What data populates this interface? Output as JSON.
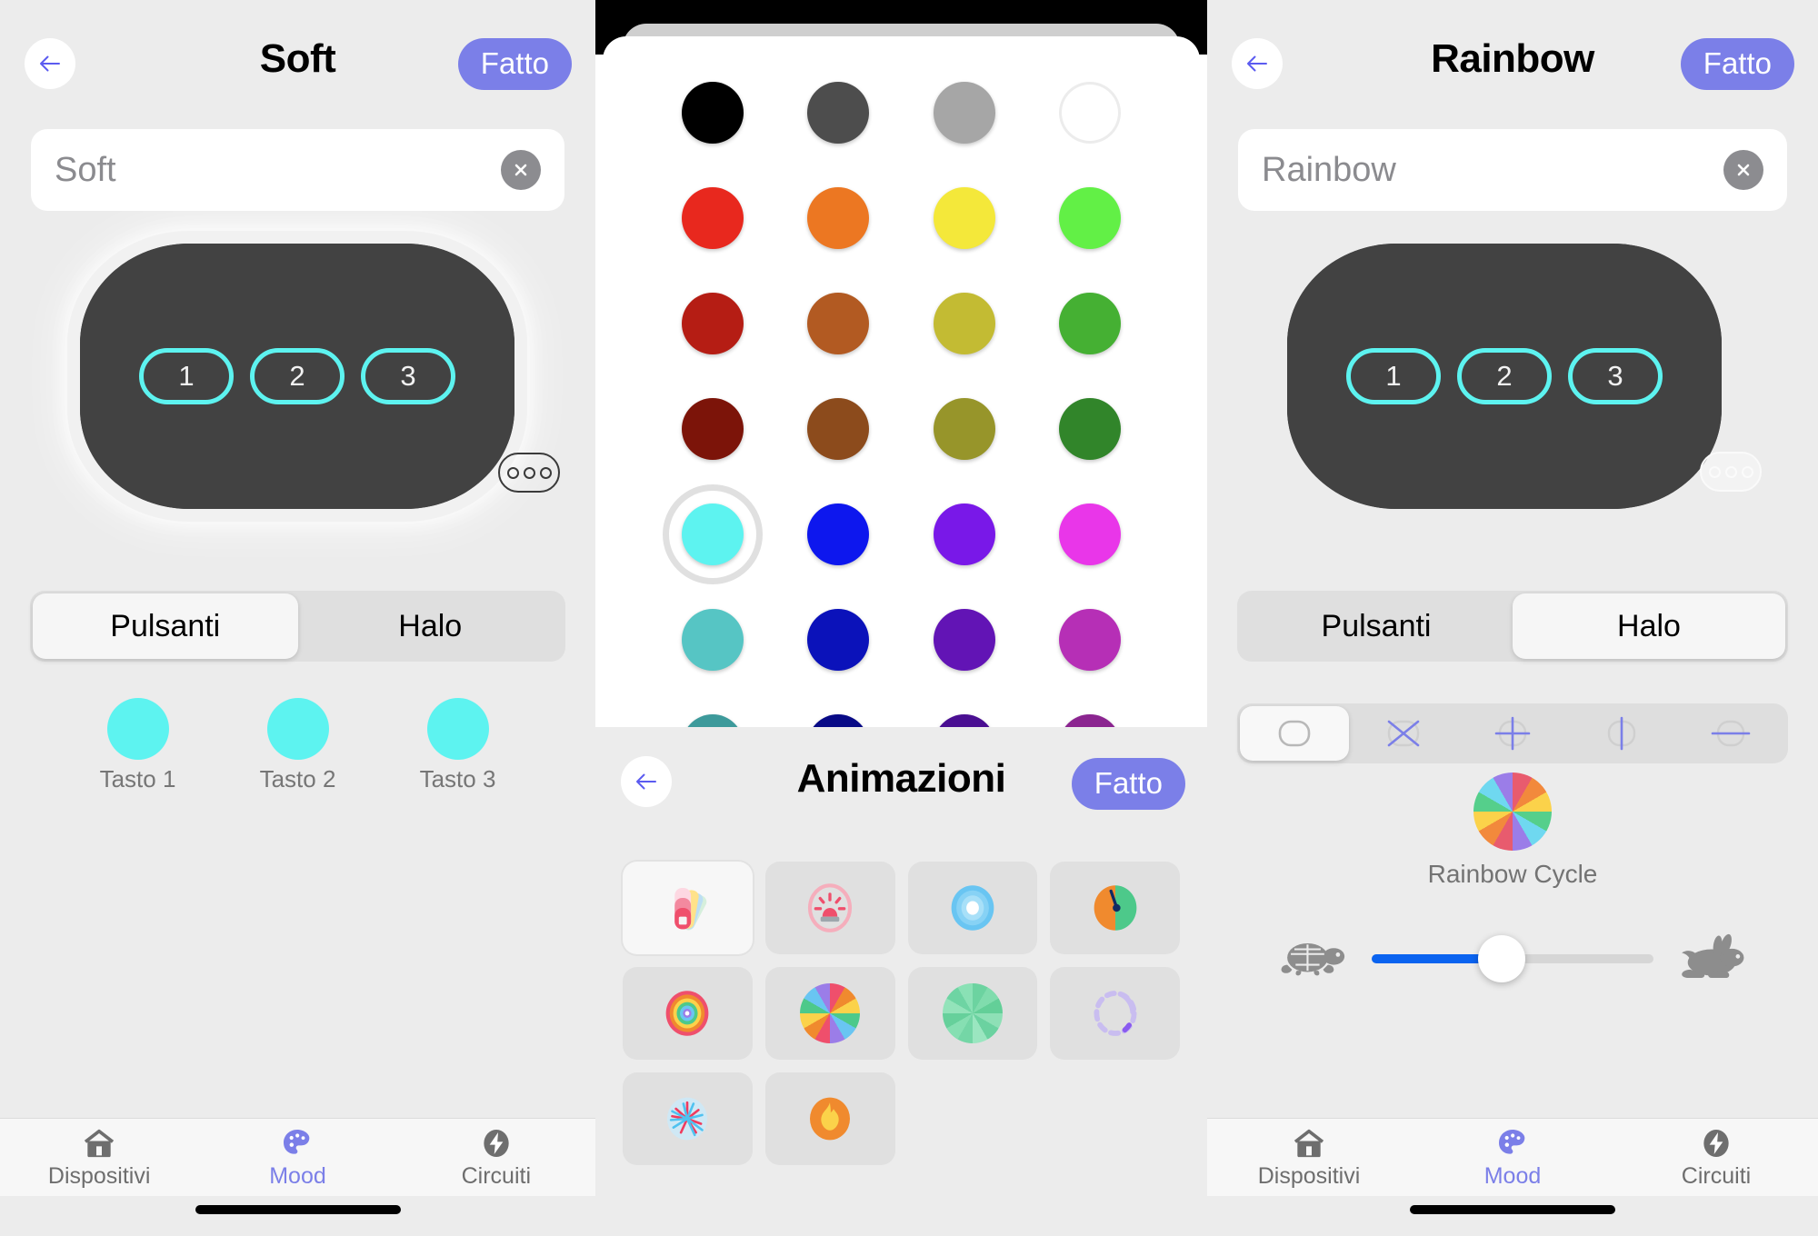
{
  "left_screen": {
    "header": {
      "title": "Soft",
      "done_label": "Fatto",
      "back_icon": "arrow-left-icon"
    },
    "name_field": {
      "value": "Soft",
      "clear_icon": "clear-circle-icon"
    },
    "device": {
      "keys": [
        "1",
        "2",
        "3"
      ],
      "halo_color": "#ffffff",
      "body_color": "#424242",
      "key_ring_color": "#5df3f0",
      "more_icon": "more-ellipsis-icon"
    },
    "segmented": {
      "options": [
        "Pulsanti",
        "Halo"
      ],
      "selected": "Pulsanti"
    },
    "buttons": [
      {
        "label": "Tasto 1",
        "color": "#5df3f0"
      },
      {
        "label": "Tasto 2",
        "color": "#5df3f0"
      },
      {
        "label": "Tasto 3",
        "color": "#5df3f0"
      }
    ],
    "tabbar": {
      "items": [
        {
          "label": "Dispositivi",
          "icon": "home-icon",
          "active": false
        },
        {
          "label": "Mood",
          "icon": "palette-icon",
          "active": true
        },
        {
          "label": "Circuiti",
          "icon": "bolt-icon",
          "active": false
        }
      ],
      "active_color": "#7b7fe8"
    }
  },
  "mid_screen": {
    "color_grid": {
      "columns": 4,
      "selected_index": 16,
      "colors": [
        "#000000",
        "#4d4d4d",
        "#a6a6a6",
        "#ffffff",
        "#e8281e",
        "#ec7722",
        "#f4e83a",
        "#62f046",
        "#b51d14",
        "#b25a22",
        "#c3bb33",
        "#45b033",
        "#7c1409",
        "#8c4b1c",
        "#97952a",
        "#31852a",
        "#5df3f0",
        "#0d17ee",
        "#7918e8",
        "#e936e9",
        "#56c5c4",
        "#0b12ba",
        "#6214b5",
        "#b62fb6",
        "#3d9a9b",
        "#080a86",
        "#4a0f92",
        "#8b2590"
      ]
    },
    "animations_sheet": {
      "header": {
        "title": "Animazioni",
        "done_label": "Fatto",
        "back_icon": "arrow-left-icon"
      },
      "items": [
        {
          "name": "color-swatch-fan-icon",
          "selected": true
        },
        {
          "name": "siren-beacon-icon",
          "selected": false
        },
        {
          "name": "pulse-ripple-icon",
          "selected": false
        },
        {
          "name": "two-tone-dial-icon",
          "selected": false
        },
        {
          "name": "rainbow-rings-icon",
          "selected": false
        },
        {
          "name": "color-wheel-icon",
          "selected": false
        },
        {
          "name": "green-fade-wheel-icon",
          "selected": false
        },
        {
          "name": "dashed-spinner-icon",
          "selected": false
        },
        {
          "name": "fireworks-icon",
          "selected": false
        },
        {
          "name": "flame-icon",
          "selected": false
        }
      ]
    }
  },
  "right_screen": {
    "header": {
      "title": "Rainbow",
      "done_label": "Fatto",
      "back_icon": "arrow-left-icon"
    },
    "name_field": {
      "value": "Rainbow",
      "clear_icon": "clear-circle-icon"
    },
    "device": {
      "keys": [
        "1",
        "2",
        "3"
      ],
      "halo_style": "rainbow-gradient",
      "body_color": "#424242",
      "key_ring_color": "#5df3f0",
      "more_icon": "more-ellipsis-icon"
    },
    "segmented": {
      "options": [
        "Pulsanti",
        "Halo"
      ],
      "selected": "Halo"
    },
    "halo_patterns": [
      {
        "name": "pattern-full-icon",
        "selected": true
      },
      {
        "name": "pattern-cross-diagonal-icon",
        "selected": false
      },
      {
        "name": "pattern-cross-plus-icon",
        "selected": false
      },
      {
        "name": "pattern-vertical-split-icon",
        "selected": false
      },
      {
        "name": "pattern-horizontal-split-icon",
        "selected": false
      }
    ],
    "effect": {
      "label": "Rainbow Cycle",
      "icon": "color-wheel-icon"
    },
    "speed_slider": {
      "min_icon": "turtle-icon",
      "max_icon": "rabbit-icon",
      "value_percent": 46,
      "fill_color": "#0a63f0"
    },
    "tabbar": {
      "items": [
        {
          "label": "Dispositivi",
          "icon": "home-icon",
          "active": false
        },
        {
          "label": "Mood",
          "icon": "palette-icon",
          "active": true
        },
        {
          "label": "Circuiti",
          "icon": "bolt-icon",
          "active": false
        }
      ],
      "active_color": "#7b7fe8"
    }
  }
}
